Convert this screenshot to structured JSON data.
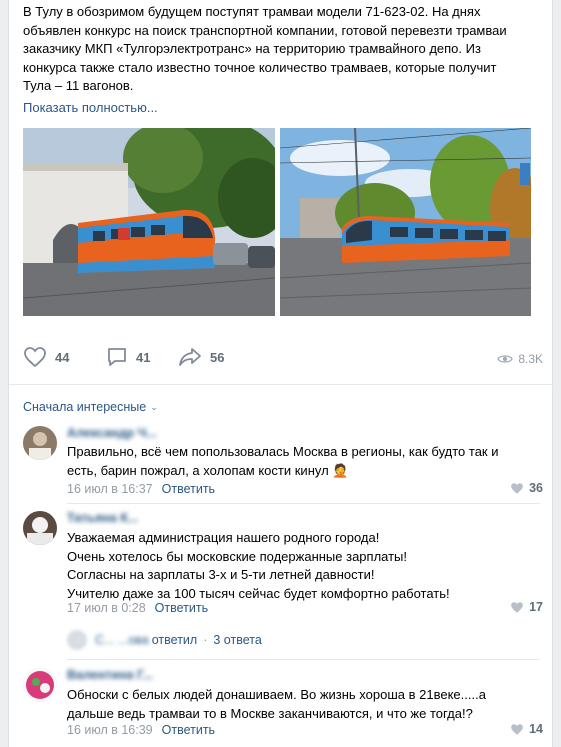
{
  "post": {
    "text": "В Тулу в обозримом будущем поступят трамваи модели 71-623-02. На днях\nобъявлен конкурс на поиск транспортной компании, готовой перевезти трамваи\nзаказчику МКП «Тулгорэлектротранс» на территорию трамвайного депо. Из\nконкурса также стало известно точное количество трамваев, которые получит\nТула – 11 вагонов.",
    "show_more": "Показать полностью...",
    "photos": [
      {
        "icon": "tram-photo-1"
      },
      {
        "icon": "tram-photo-2"
      }
    ],
    "actions": {
      "likes": "44",
      "comments": "41",
      "shares": "56",
      "views": "8.3K"
    }
  },
  "comments_section": {
    "sort_label": "Сначала интересные",
    "comments": [
      {
        "author": "Александр Ч...",
        "text": "Правильно, всё чем попользовалась Москва в регионы, как будто так и\nесть, барин пожрал, а холопам кости кинул 🤦",
        "date": "16 июл в 16:37",
        "reply_label": "Ответить",
        "likes": "36"
      },
      {
        "author": "Татьяна К...",
        "text": "Уважаемая администрация нашего родного города!\nОчень хотелось бы московские подержанные зарплаты!\nСогласны на зарплаты 3-х и 5-ти летней давности!\nУчителю даже за 100 тысяч сейчас будет комфортно работать!",
        "date": "17 июл в 0:28",
        "reply_label": "Ответить",
        "likes": "17"
      },
      {
        "author": "Валентина Г...",
        "text": "Обноски с белых людей донашиваем. Во жизнь хороша в 21веке.....а\nдальше ведь трамваи то в Москве заканчиваются, и что же тогда!?",
        "date": "16 июл в 16:39",
        "reply_label": "Ответить",
        "likes": "14"
      }
    ],
    "thread": {
      "replied_by": "С... ...ова",
      "replied_label": "ответил",
      "replies_count": "3 ответа"
    }
  },
  "colors": {
    "link": "#2a5885",
    "muted": "#939ca7",
    "tram_orange": "#e8631d",
    "tram_blue": "#3a8fd1"
  }
}
